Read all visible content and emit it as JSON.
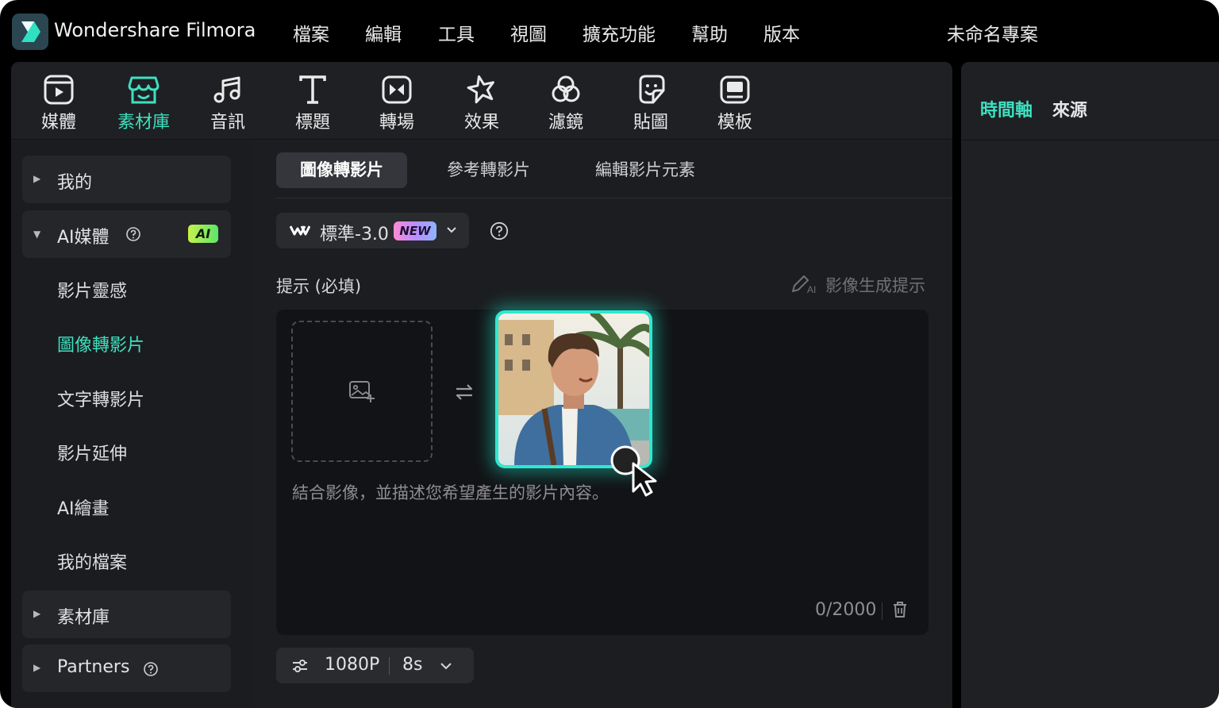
{
  "app": {
    "name": "Wondershare Filmora",
    "project_name": "未命名專案"
  },
  "menu": [
    "檔案",
    "編輯",
    "工具",
    "視圖",
    "擴充功能",
    "幫助",
    "版本"
  ],
  "toolbar": {
    "tools": [
      {
        "label": "媒體",
        "icon": "media-icon"
      },
      {
        "label": "素材庫",
        "icon": "store-icon",
        "active": true
      },
      {
        "label": "音訊",
        "icon": "music-note-icon"
      },
      {
        "label": "標題",
        "icon": "text-t-icon"
      },
      {
        "label": "轉場",
        "icon": "transition-icon"
      },
      {
        "label": "效果",
        "icon": "effects-star-icon"
      },
      {
        "label": "濾鏡",
        "icon": "filter-icon"
      },
      {
        "label": "貼圖",
        "icon": "sticker-icon"
      },
      {
        "label": "模板",
        "icon": "template-icon"
      }
    ]
  },
  "sidebar": {
    "groups": {
      "mine": "我的",
      "ai_media": "AI媒體",
      "ai_badge": "AI",
      "library": "素材庫",
      "partners": "Partners"
    },
    "ai_items": [
      "影片靈感",
      "圖像轉影片",
      "文字轉影片",
      "影片延伸",
      "AI繪畫",
      "我的檔案"
    ],
    "active_item": "圖像轉影片"
  },
  "content": {
    "tabs": [
      "圖像轉影片",
      "參考轉影片",
      "編輯影片元素"
    ],
    "active_tab": "圖像轉影片",
    "model": {
      "name": "標準-3.0",
      "badge": "NEW"
    },
    "prompt_label": "提示 (必填)",
    "generate_prompt_label": "影像生成提示",
    "prompt_placeholder": "結合影像，並描述您希望產生的影片內容。",
    "char_count": "0/2000",
    "resolution": "1080P",
    "duration": "8s"
  },
  "right_panel": {
    "tabs": [
      "時間軸",
      "來源"
    ],
    "active_tab": "時間軸"
  },
  "colors": {
    "accent": "#3ee0c0",
    "background": "#000000",
    "panel": "#1f2024",
    "glow": "#2ee8d0"
  }
}
